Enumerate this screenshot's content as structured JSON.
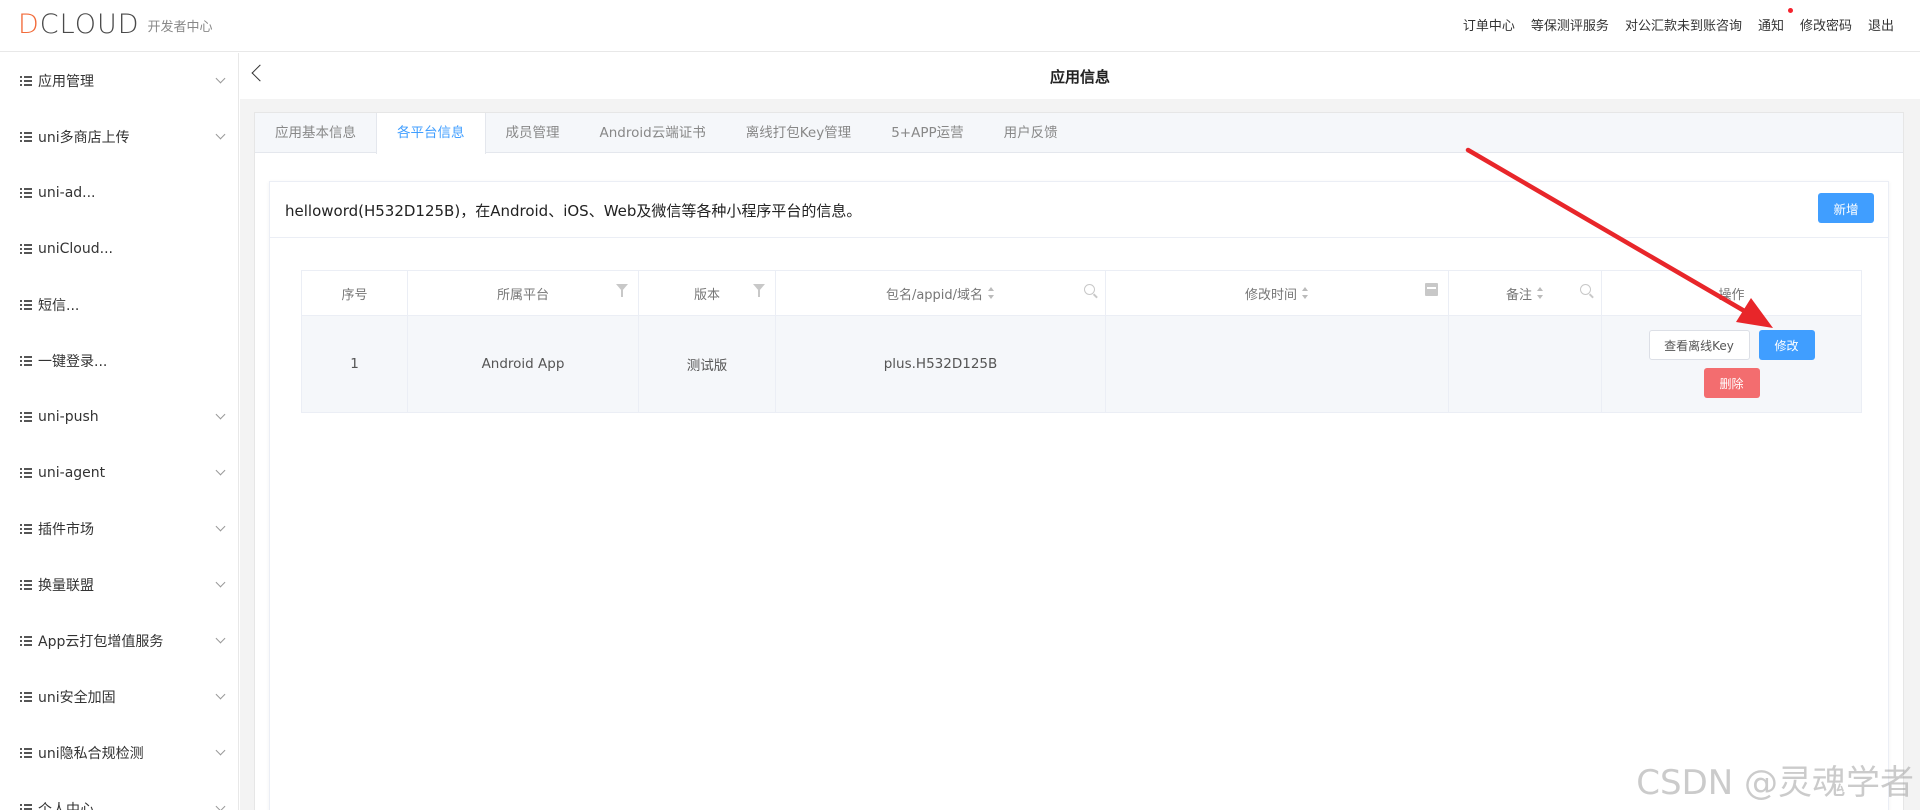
{
  "header": {
    "logo_text": "DCLOUD",
    "logo_subtitle": "开发者中心",
    "nav": [
      "订单中心",
      "等保测评服务",
      "对公汇款未到账咨询",
      "通知",
      "修改密码",
      "退出"
    ]
  },
  "sidebar": {
    "items": [
      {
        "label": "应用管理",
        "has_chevron": true
      },
      {
        "label": "uni多商店上传",
        "has_chevron": true
      },
      {
        "label": "uni-ad...",
        "has_chevron": false
      },
      {
        "label": "uniCloud...",
        "has_chevron": false
      },
      {
        "label": "短信...",
        "has_chevron": false
      },
      {
        "label": "一键登录...",
        "has_chevron": false
      },
      {
        "label": "uni-push",
        "has_chevron": true
      },
      {
        "label": "uni-agent",
        "has_chevron": true
      },
      {
        "label": "插件市场",
        "has_chevron": true
      },
      {
        "label": "换量联盟",
        "has_chevron": true
      },
      {
        "label": "App云打包增值服务",
        "has_chevron": true
      },
      {
        "label": "uni安全加固",
        "has_chevron": true
      },
      {
        "label": "uni隐私合规检测",
        "has_chevron": true
      },
      {
        "label": "个人中心",
        "has_chevron": true
      }
    ]
  },
  "main": {
    "page_title": "应用信息",
    "tabs": [
      {
        "label": "应用基本信息",
        "active": false
      },
      {
        "label": "各平台信息",
        "active": true
      },
      {
        "label": "成员管理",
        "active": false
      },
      {
        "label": "Android云端证书",
        "active": false
      },
      {
        "label": "离线打包Key管理",
        "active": false
      },
      {
        "label": "5+APP运营",
        "active": false
      },
      {
        "label": "用户反馈",
        "active": false
      }
    ],
    "card_title": "helloword(H532D125B)，在Android、iOS、Web及微信等各种小程序平台的信息。",
    "add_button": "新增",
    "table": {
      "columns": [
        "序号",
        "所属平台",
        "版本",
        "包名/appid/域名",
        "修改时间",
        "备注",
        "操作"
      ],
      "rows": [
        {
          "index": "1",
          "platform": "Android App",
          "version": "测试版",
          "package": "plus.H532D125B",
          "modified": "",
          "note": ""
        }
      ],
      "row_actions": {
        "view_key": "查看离线Key",
        "edit": "修改",
        "delete": "删除"
      }
    }
  },
  "watermark": "CSDN @灵魂学者",
  "colors": {
    "primary": "#409eff",
    "danger": "#f36d6f",
    "annotation_arrow": "#e8262a",
    "logo_accent": "#f26b3a"
  }
}
